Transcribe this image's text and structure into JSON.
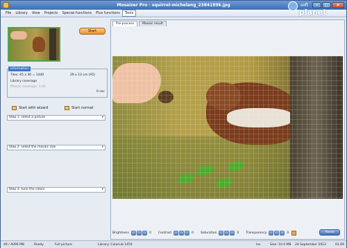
{
  "window": {
    "title": "Mosaizer Pro - squirrel-michelang_2384189k.jpg"
  },
  "watermark": {
    "small": "soft",
    "brand": "planet",
    "text": "softplanet"
  },
  "menu": {
    "items": [
      "File",
      "Library",
      "View",
      "Projects",
      "Special functions",
      "Plus functions",
      "Tools"
    ],
    "active_index": 6
  },
  "left": {
    "start_label": "Start",
    "info": {
      "header": "Information",
      "tiles": "Tiles: 45 x 30 = 1440",
      "size": "29 x 12 cm  (A5)",
      "library_coverage": "Library coverage",
      "dim_text": "Mosaic coverage: 1.00",
      "time": "0 sec"
    },
    "start_wizard": "Start with wizard",
    "start_normal": "Start normal",
    "steps": [
      "Step 1: select a picture",
      "Step 2: select the mosaic size",
      "Step 3: tune the colors"
    ]
  },
  "right": {
    "tabs": [
      "Pre-process",
      "Mosaic result"
    ],
    "active_tab": 0,
    "controls": [
      {
        "label": "Brightness",
        "value": "0"
      },
      {
        "label": "Contrast",
        "value": "0"
      },
      {
        "label": "Saturation",
        "value": "0"
      },
      {
        "label": "Transparency",
        "value": "0"
      }
    ],
    "reset_label": "Reset"
  },
  "status": {
    "memory": "49 / 4096 MB",
    "state": "Ready",
    "mode": "Full picture",
    "library": "Library: ColorLib 1450",
    "ins": "Ins",
    "size": "Size: 10.0 MB",
    "date": "24 September 2013",
    "time": "01:09"
  },
  "colors": {
    "title_bar": "#3d6fb6",
    "start_button": "#f08c2c",
    "reset_button": "#3f6fb6",
    "info_header": "#3b77c9"
  }
}
